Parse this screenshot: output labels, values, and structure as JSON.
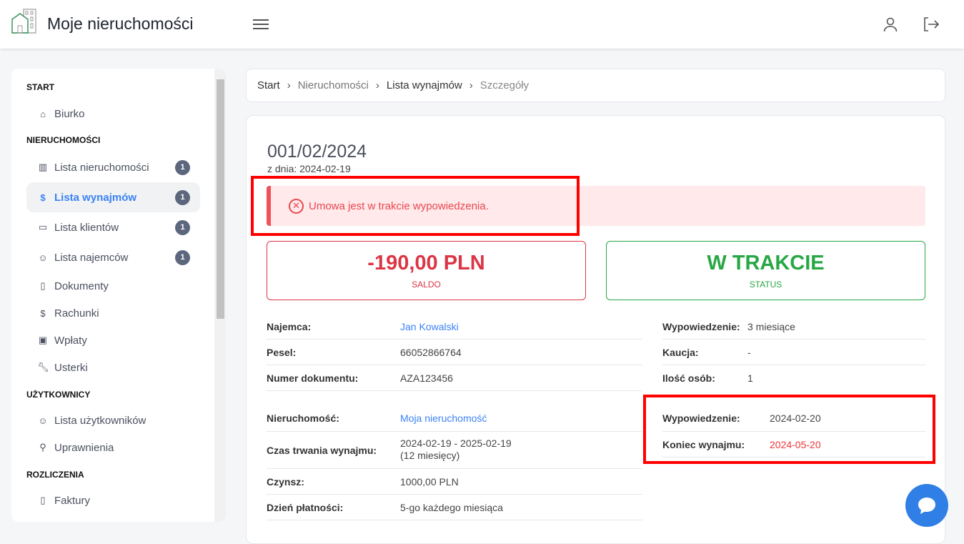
{
  "header": {
    "title": "Moje nieruchomości"
  },
  "sidebar": {
    "sections": [
      "START",
      "NIERUCHOMOŚCI",
      "UŻYTKOWNICY",
      "ROZLICZENIA"
    ],
    "items": [
      {
        "label": "Biurko",
        "icon": "home-icon"
      },
      {
        "label": "Lista nieruchomości",
        "icon": "building-icon",
        "badge": "1"
      },
      {
        "label": "Lista wynajmów",
        "icon": "dollar-icon",
        "badge": "1"
      },
      {
        "label": "Lista klientów",
        "icon": "briefcase-icon",
        "badge": "1"
      },
      {
        "label": "Lista najemców",
        "icon": "user-icon",
        "badge": "1"
      },
      {
        "label": "Dokumenty",
        "icon": "file-icon"
      },
      {
        "label": "Rachunki",
        "icon": "dollar-icon"
      },
      {
        "label": "Wpłaty",
        "icon": "cash-icon"
      },
      {
        "label": "Usterki",
        "icon": "wrench-icon"
      },
      {
        "label": "Lista użytkowników",
        "icon": "users-icon"
      },
      {
        "label": "Uprawnienia",
        "icon": "key-icon"
      },
      {
        "label": "Faktury",
        "icon": "pdf-icon"
      }
    ]
  },
  "breadcrumb": [
    "Start",
    "Nieruchomości",
    "Lista wynajmów",
    "Szczegóły"
  ],
  "rental": {
    "number": "001/02/2024",
    "date": "z dnia: 2024-02-19",
    "alert": "Umowa jest w trakcie wypowiedzenia.",
    "balance": {
      "value": "-190,00 PLN",
      "label": "SALDO"
    },
    "status": {
      "value": "W TRAKCIE",
      "label": "STATUS"
    },
    "left1": [
      {
        "k": "Najemca:",
        "v": "Jan Kowalski"
      },
      {
        "k": "Pesel:",
        "v": "66052866764"
      },
      {
        "k": "Numer dokumentu:",
        "v": "AZA123456"
      }
    ],
    "right1": [
      {
        "k": "Wypowiedzenie:",
        "v": "3 miesiące"
      },
      {
        "k": "Kaucja:",
        "v": "-"
      },
      {
        "k": "Ilość osób:",
        "v": "1"
      }
    ],
    "left2": [
      {
        "k": "Nieruchomość:",
        "v": "Moja nieruchomość"
      },
      {
        "k": "Czas trwania wynajmu:",
        "v": "2024-02-19 - 2025-02-19",
        "v2": "(12 miesięcy)"
      },
      {
        "k": "Czynsz:",
        "v": "1000,00 PLN"
      },
      {
        "k": "Dzień płatności:",
        "v": "5-go każdego miesiąca"
      }
    ],
    "right2": [
      {
        "k": "Wypowiedzenie:",
        "v": "2024-02-20"
      },
      {
        "k": "Koniec wynajmu:",
        "v": "2024-05-20"
      }
    ]
  },
  "colors": {
    "accent": "#3b82f6",
    "danger": "#dc3545",
    "success": "#28a745"
  }
}
